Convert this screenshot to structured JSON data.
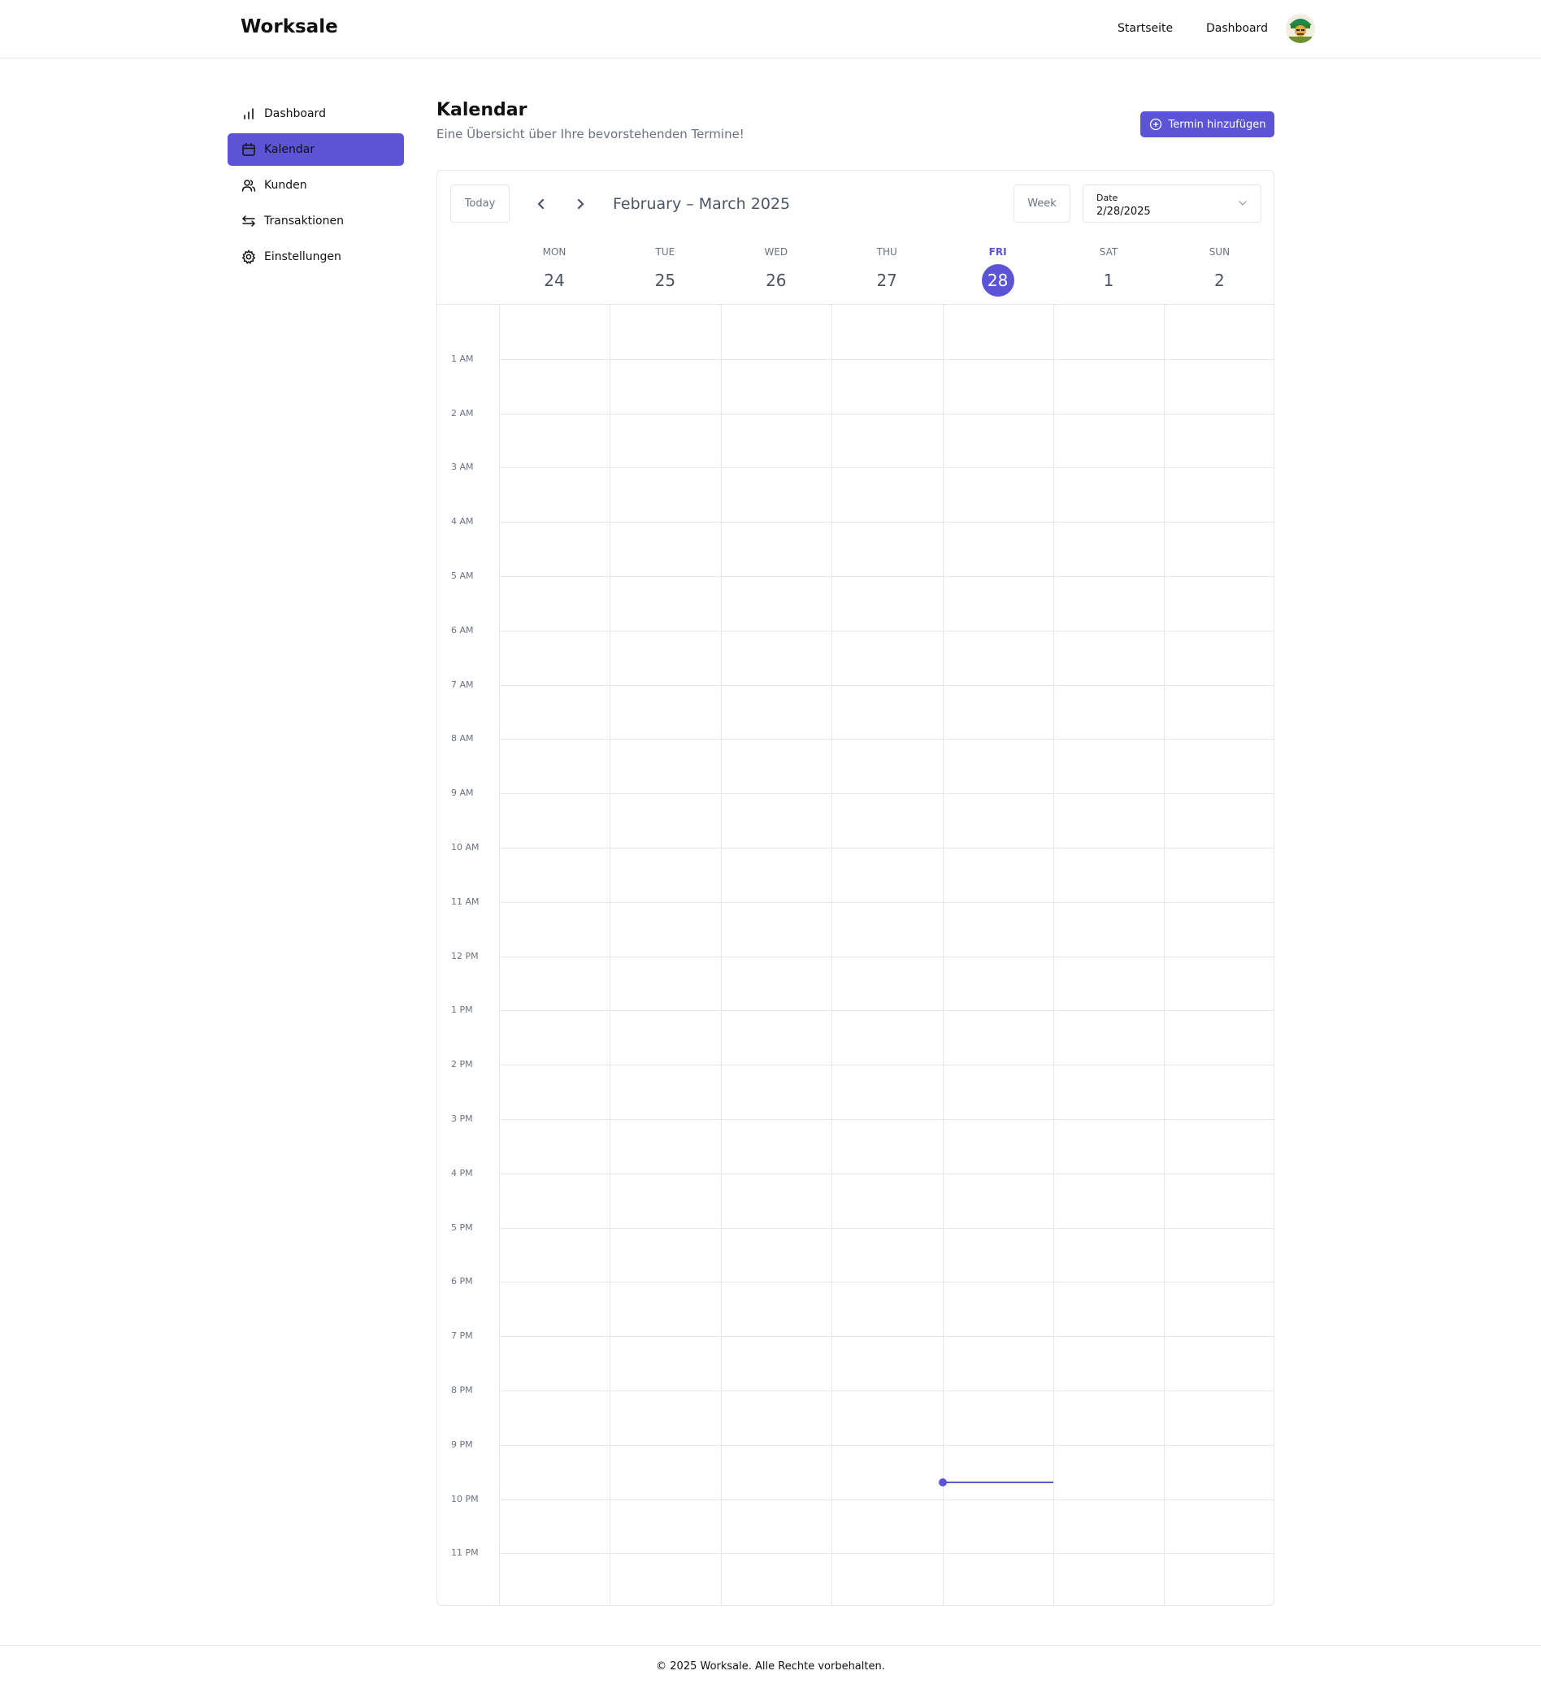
{
  "header": {
    "brand": "Worksale",
    "nav": {
      "home": "Startseite",
      "dashboard": "Dashboard"
    },
    "avatar_icon": "user-avatar"
  },
  "sidebar": {
    "items": [
      {
        "label": "Dashboard",
        "icon": "bar-chart-icon",
        "active": false
      },
      {
        "label": "Kalendar",
        "icon": "calendar-icon",
        "active": true
      },
      {
        "label": "Kunden",
        "icon": "users-icon",
        "active": false
      },
      {
        "label": "Transaktionen",
        "icon": "arrows-exchange-icon",
        "active": false
      },
      {
        "label": "Einstellungen",
        "icon": "gear-icon",
        "active": false
      }
    ]
  },
  "page": {
    "title": "Kalendar",
    "subtitle": "Eine Übersicht über Ihre bevorstehenden Termine!",
    "add_button": "Termin hinzufügen"
  },
  "calendar": {
    "today_button": "Today",
    "range_label": "February – March 2025",
    "view_button": "Week",
    "date_field": {
      "legend": "Date",
      "value": "2/28/2025"
    },
    "days": [
      {
        "dow": "MON",
        "dom": "24"
      },
      {
        "dow": "TUE",
        "dom": "25"
      },
      {
        "dow": "WED",
        "dom": "26"
      },
      {
        "dow": "THU",
        "dom": "27"
      },
      {
        "dow": "FRI",
        "dom": "28",
        "today": true
      },
      {
        "dow": "SAT",
        "dom": "1"
      },
      {
        "dow": "SUN",
        "dom": "2"
      }
    ],
    "hours": [
      "1 AM",
      "2 AM",
      "3 AM",
      "4 AM",
      "5 AM",
      "6 AM",
      "7 AM",
      "8 AM",
      "9 AM",
      "10 AM",
      "11 AM",
      "12 PM",
      "1 PM",
      "2 PM",
      "3 PM",
      "4 PM",
      "5 PM",
      "6 PM",
      "7 PM",
      "8 PM",
      "9 PM",
      "10 PM",
      "11 PM"
    ],
    "current_time_fraction_of_day": 0.904
  },
  "footer": {
    "text": "© 2025 Worksale. Alle Rechte vorbehalten."
  },
  "colors": {
    "accent": "#5b54d6",
    "border": "#e5e7eb",
    "muted": "#6b7280"
  }
}
